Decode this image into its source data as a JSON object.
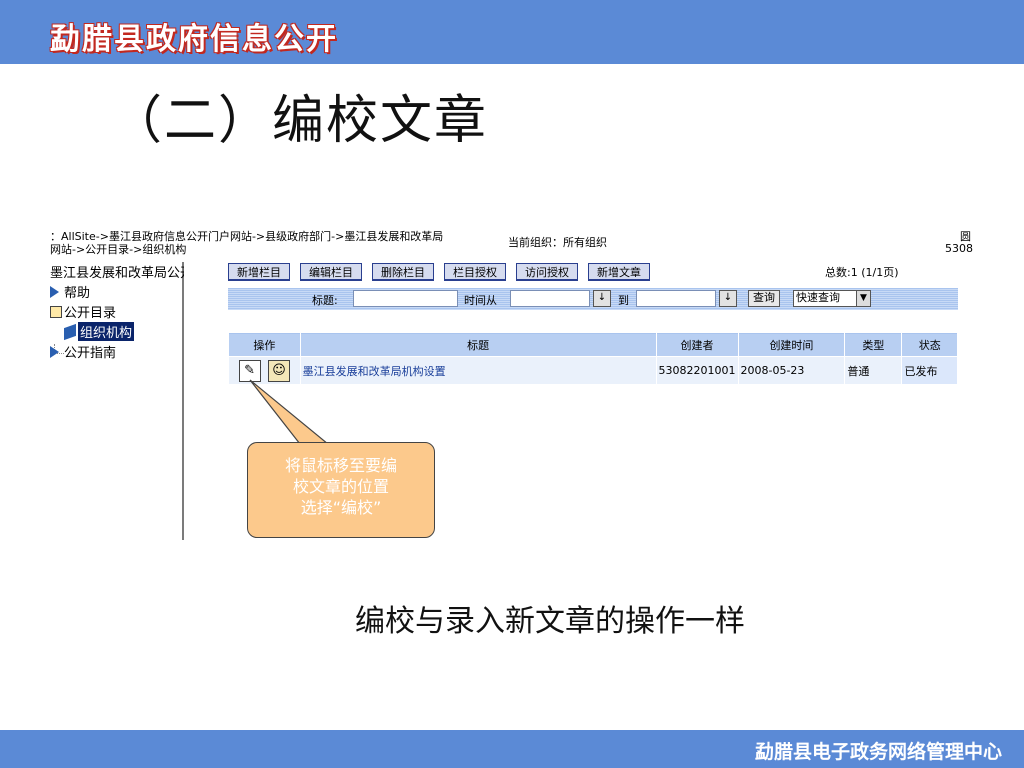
{
  "header": {
    "title": "勐腊县政府信息公开"
  },
  "slide": {
    "heading": "（二）编校文章"
  },
  "screenshot": {
    "path_line1": "：AllSite->墨江县政府信息公开门户网站->县级政府部门->墨江县发展和改革局",
    "path_line2": "网站->公开目录->组织机构",
    "current_org": "当前组织：所有组织",
    "right_edge1": "圆",
    "right_edge2": "5308",
    "tree": {
      "root": "墨江县发展和改革局公开",
      "items": [
        {
          "label": "帮助",
          "icon": "arrow-icon"
        },
        {
          "label": "公开目录",
          "icon": "doc-icon"
        },
        {
          "label": "组织机构",
          "icon": "book-icon",
          "selected": true
        },
        {
          "label": "公开指南",
          "icon": "arrow-icon"
        }
      ]
    },
    "toolbar": {
      "buttons": [
        "新增栏目",
        "编辑栏目",
        "删除栏目",
        "栏目授权",
        "访问授权",
        "新增文章"
      ],
      "total": "总数:1 (1/1页)"
    },
    "search": {
      "title_label": "标题:",
      "time_from_label": "时间从",
      "to_label": "到",
      "query_button": "查询",
      "quick_select": "快速查询",
      "dropdown_glyph": "↓",
      "select_glyph": "▼"
    },
    "grid": {
      "headers": [
        "操作",
        "标题",
        "创建者",
        "创建时间",
        "类型",
        "状态"
      ],
      "rows": [
        {
          "actions": [
            "edit-icon",
            "people-icon"
          ],
          "title": "墨江县发展和改革局机构设置",
          "creator": "53082201001",
          "created": "2008-05-23",
          "type": "普通",
          "status": "已发布"
        }
      ]
    }
  },
  "callout": {
    "lines": [
      "将鼠标移至要编",
      "校文章的位置",
      "选择“编校”"
    ]
  },
  "caption": "编校与录入新文章的操作一样",
  "footer": {
    "text": "勐腊县电子政务网络管理中心"
  },
  "colors": {
    "bar": "#5b8ad6",
    "title_outline": "#c2281f",
    "callout_fill": "#fcc98c"
  }
}
